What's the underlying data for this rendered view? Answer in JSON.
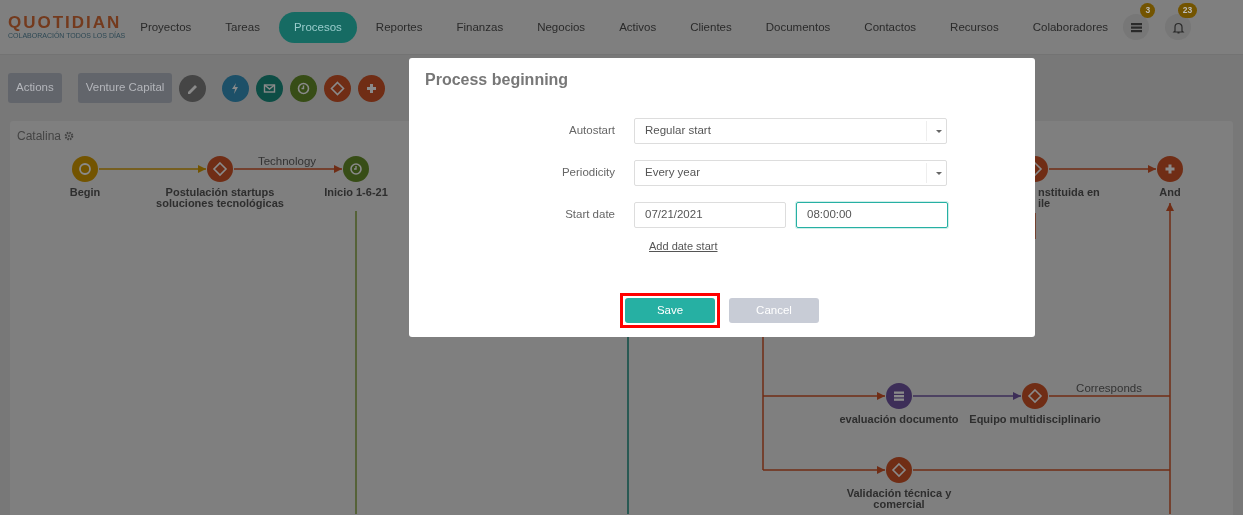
{
  "logo": {
    "name": "QUOTIDIAN",
    "tagline": "COLABORACIÓN TODOS LOS DÍAS"
  },
  "nav": [
    {
      "label": "Proyectos",
      "selected": false
    },
    {
      "label": "Tareas",
      "selected": false
    },
    {
      "label": "Procesos",
      "selected": true
    },
    {
      "label": "Reportes",
      "selected": false
    },
    {
      "label": "Finanzas",
      "selected": false
    },
    {
      "label": "Negocios",
      "selected": false
    },
    {
      "label": "Activos",
      "selected": false
    },
    {
      "label": "Clientes",
      "selected": false
    },
    {
      "label": "Documentos",
      "selected": false
    },
    {
      "label": "Contactos",
      "selected": false
    },
    {
      "label": "Recursos",
      "selected": false
    },
    {
      "label": "Colaboradores",
      "selected": false
    }
  ],
  "header_icons": [
    {
      "kind": "list",
      "badge": "3"
    },
    {
      "kind": "bell",
      "badge": "23"
    }
  ],
  "toolbar": {
    "buttons": [
      "Actions",
      "Venture Capital"
    ],
    "icons": [
      {
        "kind": "pencil",
        "color": "#454545"
      },
      {
        "kind": "bolt",
        "color": "#1d5068"
      },
      {
        "kind": "mail",
        "color": "#0d4d45"
      },
      {
        "kind": "clock",
        "color": "#374d16"
      },
      {
        "kind": "diamond",
        "color": "#702d15"
      },
      {
        "kind": "plus",
        "color": "#702d15"
      }
    ]
  },
  "canvas": {
    "title": "Catalina",
    "nodes": [
      {
        "kind": "start",
        "color": "#735400",
        "lines": [
          "Begin"
        ]
      },
      {
        "kind": "gateway",
        "color": "#702d15",
        "lines": [
          "Postulación startups",
          "soluciones tecnológicas"
        ]
      },
      {
        "kind": "timer",
        "color": "#374d16",
        "lines": [
          "Inicio 1-6-21"
        ]
      },
      {
        "kind": "gateway",
        "color": "#702d15",
        "lines": [
          "nstituida en",
          "ile"
        ]
      },
      {
        "kind": "parallel",
        "color": "#702d15",
        "lines": [
          "And"
        ]
      },
      {
        "kind": "document",
        "color": "#3d2e58",
        "lines": [
          "evaluación documento"
        ]
      },
      {
        "kind": "gateway",
        "color": "#702d15",
        "lines": [
          "Equipo multidisciplinario"
        ]
      },
      {
        "kind": "gateway",
        "color": "#702d15",
        "lines": [
          "Validación técnica y",
          "comercial"
        ]
      }
    ],
    "edge_labels": [
      "Technology",
      "Corresponds"
    ]
  },
  "dialog": {
    "title": "Process beginning",
    "fields": [
      {
        "kind": "select",
        "label": "Autostart",
        "value": "Regular start"
      },
      {
        "kind": "select",
        "label": "Periodicity",
        "value": "Every year"
      },
      {
        "kind": "datetime",
        "label": "Start date",
        "value": "07/21/2021",
        "time": "08:00:00",
        "focused": true
      }
    ],
    "link": "Add date start",
    "buttons": [
      {
        "label": "Save",
        "kind": "primary",
        "highlighted": true
      },
      {
        "label": "Cancel",
        "kind": "secondary",
        "highlighted": false
      }
    ]
  }
}
